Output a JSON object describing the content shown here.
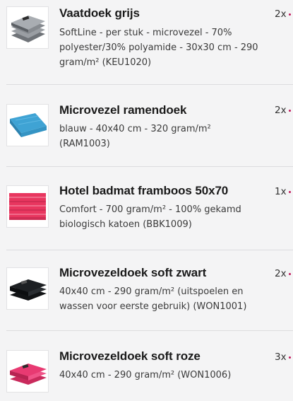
{
  "items": [
    {
      "title": "Vaatdoek grijs",
      "description": "SoftLine - per stuk - microvezel - 70% polyester/30% polyamide - 30x30 cm - 290 gram/m² (KEU1020)",
      "quantity": "2x",
      "image_icon": "grey-dishcloth-stack-icon",
      "color": "#8d9196"
    },
    {
      "title": "Microvezel ramendoek",
      "description": "blauw - 40x40 cm - 320 gram/m² (RAM1003)",
      "quantity": "2x",
      "image_icon": "blue-window-cloth-icon",
      "color": "#3fa3d4"
    },
    {
      "title": "Hotel badmat framboos 50x70",
      "description": "Comfort - 700 gram/m² - 100% gekamd biologisch katoen (BBK1009)",
      "quantity": "1x",
      "image_icon": "raspberry-bath-mat-icon",
      "color": "#e8365f"
    },
    {
      "title": "Microvezeldoek soft zwart",
      "description": "40x40 cm - 290 gram/m² (uitspoelen en wassen voor eerste gebruik) (WON1001)",
      "quantity": "2x",
      "image_icon": "black-microfiber-cloth-icon",
      "color": "#1d2023"
    },
    {
      "title": "Microvezeldoek soft roze",
      "description": "40x40 cm - 290 gram/m² (WON1006)",
      "quantity": "3x",
      "image_icon": "pink-microfiber-cloth-icon",
      "color": "#e83a72"
    }
  ]
}
